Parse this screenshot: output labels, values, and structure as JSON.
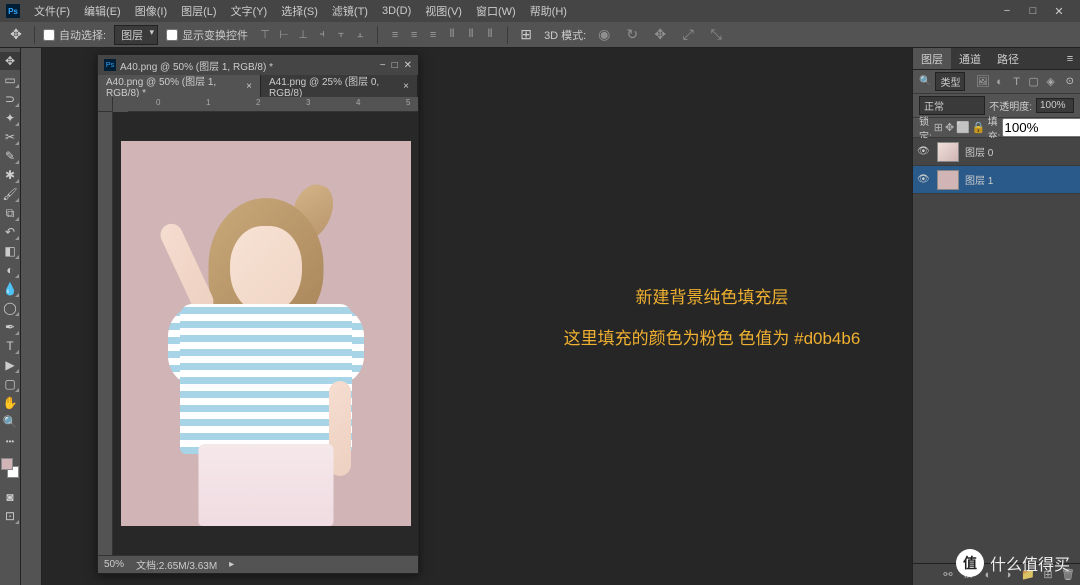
{
  "menu": {
    "items": [
      "文件(F)",
      "编辑(E)",
      "图像(I)",
      "图层(L)",
      "文字(Y)",
      "选择(S)",
      "滤镜(T)",
      "3D(D)",
      "视图(V)",
      "窗口(W)",
      "帮助(H)"
    ]
  },
  "options": {
    "auto_select_label": "自动选择:",
    "auto_select_mode": "图层",
    "show_transform_label": "显示变换控件",
    "mode_3d_label": "3D 模式:"
  },
  "doc_window": {
    "title": "A40.png @ 50% (图层 1, RGB/8) *",
    "tabs": [
      {
        "label": "A40.png @ 50% (图层 1, RGB/8) *",
        "active": true
      },
      {
        "label": "A41.png @ 25% (图层 0, RGB/8)",
        "active": false
      }
    ],
    "zoom": "50%",
    "filesize": "文档:2.65M/3.63M"
  },
  "annotation": {
    "line1": "新建背景纯色填充层",
    "line2": "这里填充的颜色为粉色 色值为 #d0b4b6"
  },
  "panels": {
    "tabs": [
      "图层",
      "通道",
      "路径"
    ],
    "filter_label": "类型",
    "blend_mode": "正常",
    "opacity_label": "不透明度:",
    "opacity_value": "100%",
    "lock_label": "锁定:",
    "fill_label": "填充:",
    "fill_value": "100%",
    "layers": [
      {
        "name": "图层 0",
        "selected": false,
        "thumb": "img"
      },
      {
        "name": "图层 1",
        "selected": true,
        "thumb": "solid"
      }
    ]
  },
  "watermark": {
    "badge": "值",
    "text": "什么值得买"
  },
  "colors": {
    "fill": "#d0b4b6"
  }
}
